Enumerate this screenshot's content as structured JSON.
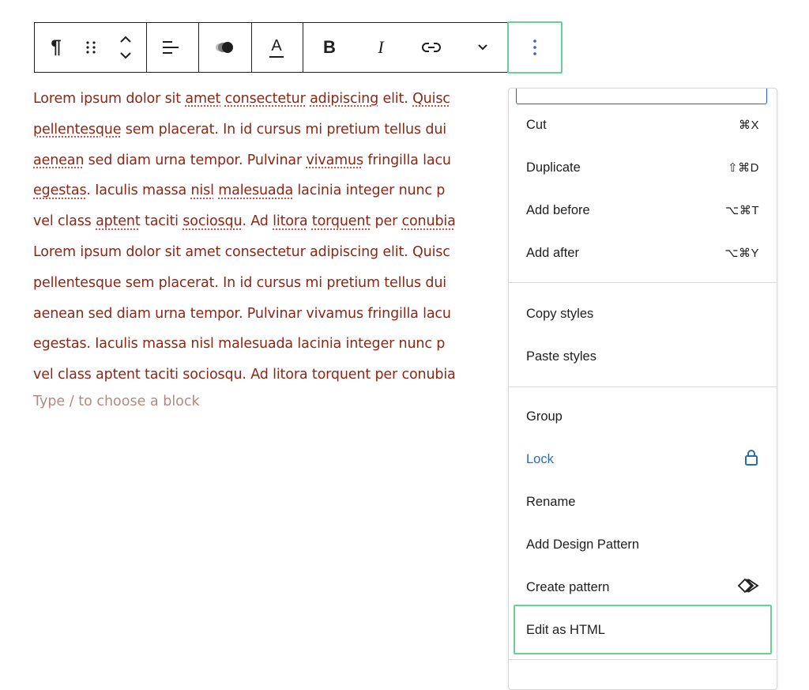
{
  "toolbar": {
    "paragraph_icon": "¶",
    "bold_label": "B",
    "italic_label": "I",
    "text_color_label": "A"
  },
  "paragraph": {
    "lines": [
      [
        "Lorem ipsum dolor sit ",
        {
          "w": "amet"
        },
        " ",
        {
          "w": "consectetur"
        },
        " ",
        {
          "w": "adipiscing"
        },
        " elit. ",
        {
          "w": "Quisc"
        }
      ],
      [
        {
          "w": "pellentesque"
        },
        " sem placerat. In id cursus mi pretium tellus dui"
      ],
      [
        {
          "w": "aenean"
        },
        " sed diam urna tempor. Pulvinar ",
        {
          "w": "vivamus"
        },
        " fringilla lacu"
      ],
      [
        {
          "w": "egestas"
        },
        ". Iaculis massa ",
        {
          "w": "nisl"
        },
        " ",
        {
          "w": "malesuada"
        },
        " lacinia integer nunc p"
      ],
      [
        "vel class ",
        {
          "w": "aptent"
        },
        " taciti ",
        {
          "w": "sociosqu"
        },
        ". Ad ",
        {
          "w": "litora"
        },
        " ",
        {
          "w": "torquent"
        },
        " per ",
        {
          "w": "conubia"
        }
      ],
      [
        "Lorem ipsum dolor sit amet consectetur adipiscing elit. Quisc"
      ],
      [
        "pellentesque sem placerat. In id cursus mi pretium tellus dui"
      ],
      [
        "aenean sed diam urna tempor. Pulvinar vivamus fringilla lacu"
      ],
      [
        "egestas. Iaculis massa nisl malesuada lacinia integer nunc p"
      ],
      [
        "vel class aptent taciti sociosqu. Ad litora torquent per conubia"
      ]
    ],
    "placeholder": "Type / to choose a block"
  },
  "menu": {
    "items": [
      {
        "label": "Cut",
        "shortcut": "⌘X"
      },
      {
        "label": "Duplicate",
        "shortcut": "⇧⌘D"
      },
      {
        "label": "Add before",
        "shortcut": "⌥⌘T"
      },
      {
        "label": "Add after",
        "shortcut": "⌥⌘Y"
      },
      {
        "label": "Copy styles",
        "shortcut": ""
      },
      {
        "label": "Paste styles",
        "shortcut": ""
      },
      {
        "label": "Group",
        "shortcut": ""
      },
      {
        "label": "Lock",
        "shortcut": "",
        "icon": "lock-icon"
      },
      {
        "label": "Rename",
        "shortcut": ""
      },
      {
        "label": "Add Design Pattern",
        "shortcut": ""
      },
      {
        "label": "Create pattern",
        "shortcut": "",
        "icon": "pattern-diamond-icon"
      },
      {
        "label": "Edit as HTML",
        "shortcut": ""
      }
    ]
  },
  "colors": {
    "text": "#8a2716",
    "placeholder": "#b08a82",
    "highlight": "#6bcf9a",
    "lock": "#2b6cb0",
    "focus": "#3858e9"
  }
}
